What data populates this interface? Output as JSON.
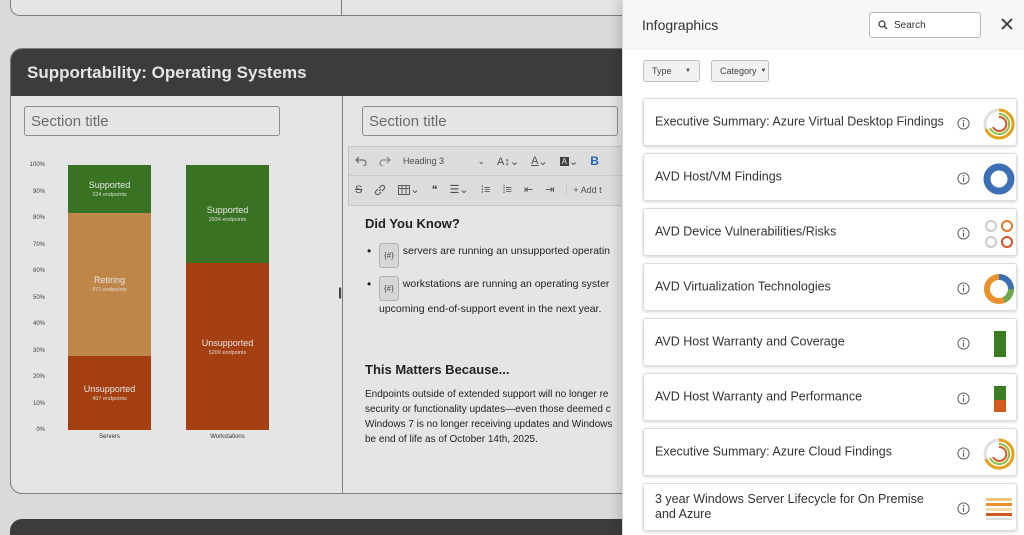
{
  "section": {
    "title": "Supportability: Operating Systems",
    "left_title_placeholder": "Section title",
    "right_title_placeholder": "Section title"
  },
  "chart_data": {
    "type": "bar",
    "stacked": true,
    "categories": [
      "Servers",
      "Workstations"
    ],
    "y_ticks": [
      "100%",
      "90%",
      "80%",
      "70%",
      "60%",
      "50%",
      "40%",
      "30%",
      "20%",
      "10%",
      "0%"
    ],
    "ylim": [
      0,
      100
    ],
    "series": [
      {
        "name": "Unsupported",
        "color": "#b5430e",
        "values": [
          28,
          63
        ],
        "sub": [
          "497 endpoints",
          "5200 endpoints"
        ]
      },
      {
        "name": "Retiring",
        "color": "#d4934f",
        "values": [
          54,
          0
        ],
        "sub": [
          "971 endpoints",
          ""
        ]
      },
      {
        "name": "Supported",
        "color": "#3c7d22",
        "values": [
          18,
          37
        ],
        "sub": [
          "324 endpoints",
          "2934 endpoints"
        ]
      }
    ]
  },
  "toolbar": {
    "heading_select": "Heading 3",
    "bold": "B",
    "add_label": "+ Add t"
  },
  "content": {
    "heading1": "Did You Know?",
    "token": "{#}",
    "bullet1": "servers are running an unsupported operatin",
    "bullet2_line1": "workstations are running an operating syster",
    "bullet2_line2": "upcoming end-of-support event in the next year.",
    "heading2": "This Matters Because...",
    "para_lines": [
      "Endpoints outside of extended support will no longer re",
      "security or functionality updates—even those deemed c",
      "Windows 7 is no longer receiving updates and Windows",
      "be end of life as of October 14th, 2025."
    ]
  },
  "panel": {
    "title": "Infographics",
    "search_placeholder": "Search",
    "filters": [
      {
        "label": "Type"
      },
      {
        "label": "Category"
      }
    ],
    "items": [
      {
        "title": "Executive Summary: Azure Virtual Desktop Findings",
        "thumb": "ring-orange-green"
      },
      {
        "title": "AVD Host/VM Findings",
        "thumb": "donut-blue"
      },
      {
        "title": "AVD Device Vulnerabilities/Risks",
        "thumb": "mini-gauges"
      },
      {
        "title": "AVD Virtualization Technologies",
        "thumb": "donut-multi"
      },
      {
        "title": "AVD Host Warranty and Coverage",
        "thumb": "bar-green"
      },
      {
        "title": "AVD Host Warranty and Performance",
        "thumb": "bar-green-orange"
      },
      {
        "title": "Executive Summary: Azure Cloud Findings",
        "thumb": "ring-orange-green"
      },
      {
        "title": "3 year Windows Server Lifecycle for On Premise and Azure",
        "thumb": "table-heatmap"
      }
    ]
  }
}
